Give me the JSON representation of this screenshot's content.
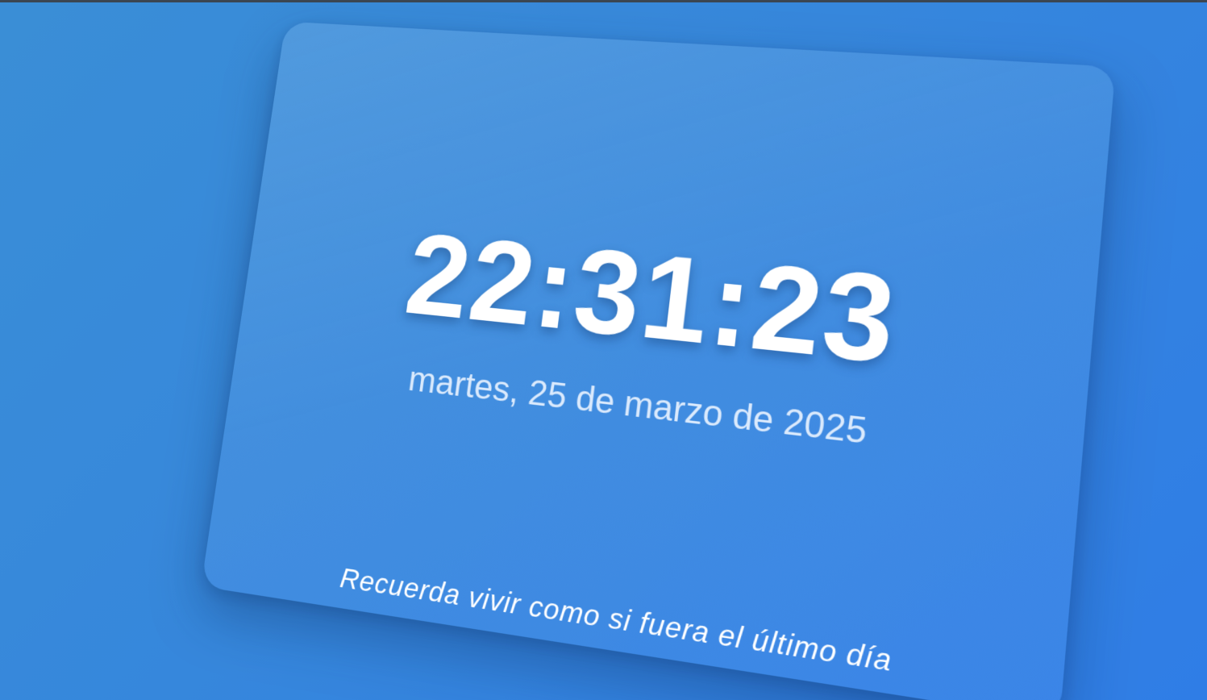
{
  "clock": {
    "time": "22:31:23",
    "date": "martes, 25 de marzo de 2025"
  },
  "quote": {
    "text": "Recuerda vivir como si fuera el último día"
  }
}
